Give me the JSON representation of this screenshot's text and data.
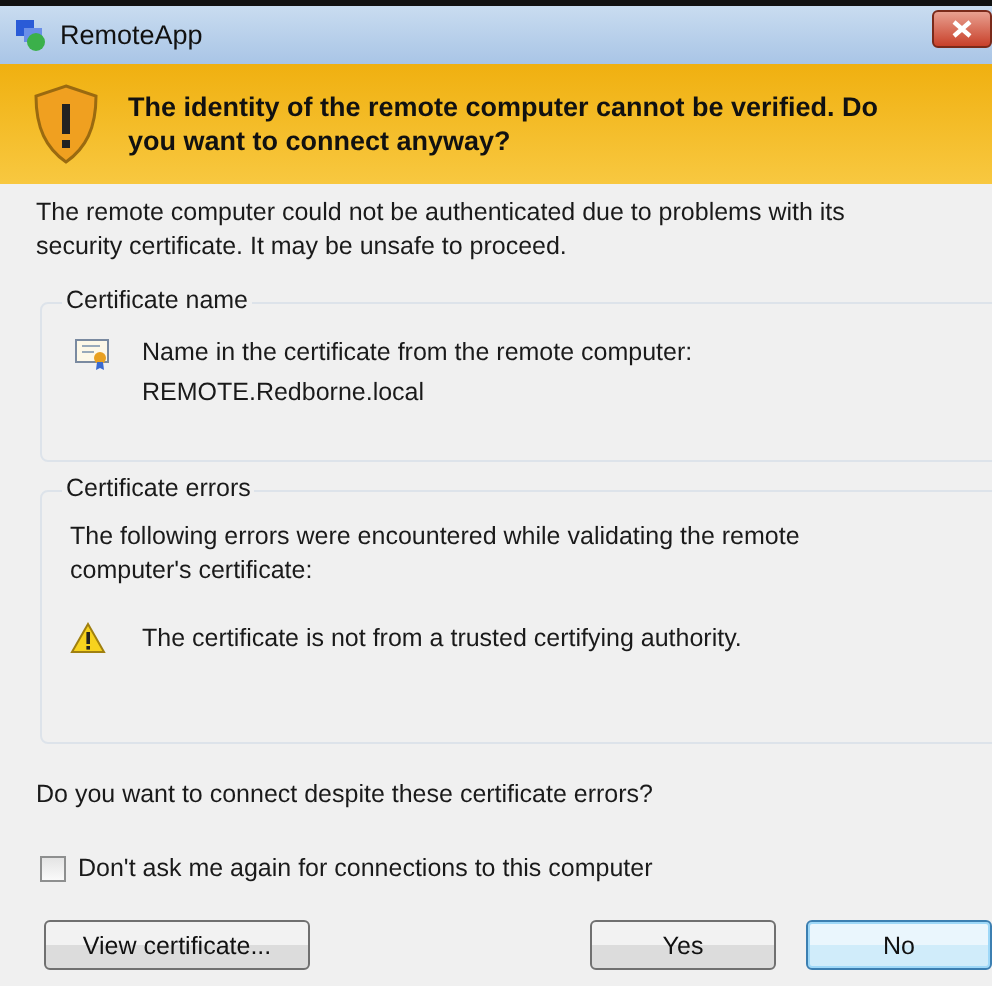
{
  "window": {
    "title": "RemoteApp"
  },
  "banner": {
    "heading": "The identity of the remote computer cannot be verified. Do\nyou want to connect anyway?"
  },
  "intro": "The remote computer could not be authenticated due to problems with its\nsecurity certificate. It may be unsafe to proceed.",
  "groups": [
    {
      "legend": "Certificate name",
      "kind": "certificate",
      "lines": [
        "Name in the certificate from the remote computer:",
        "REMOTE.Redborne.local"
      ]
    },
    {
      "legend": "Certificate errors",
      "kind": "errors",
      "description": "The following errors were encountered while validating the remote\ncomputer's certificate:",
      "errors": [
        "The certificate is not from a trusted certifying authority."
      ]
    }
  ],
  "question": "Do you want to connect despite these certificate errors?",
  "dont_ask": {
    "label": "Don't ask me again for connections to this computer",
    "checked": false
  },
  "buttons": [
    {
      "label": "View certificate...",
      "kind": "left",
      "default": false
    },
    {
      "label": "Yes",
      "kind": "right",
      "default": false
    },
    {
      "label": "No",
      "kind": "right",
      "default": true
    }
  ]
}
